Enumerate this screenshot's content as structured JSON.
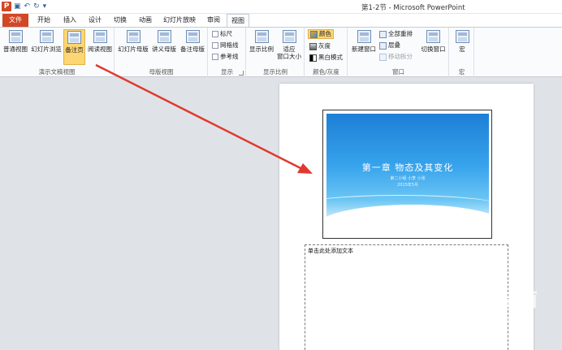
{
  "window": {
    "app_logo": "P",
    "title": "第1-2节 - Microsoft PowerPoint",
    "qat": [
      "save-icon",
      "undo-icon",
      "redo-icon",
      "customize-icon"
    ]
  },
  "tabs": [
    {
      "label": "文件"
    },
    {
      "label": "开始"
    },
    {
      "label": "插入"
    },
    {
      "label": "设计"
    },
    {
      "label": "切换"
    },
    {
      "label": "动画"
    },
    {
      "label": "幻灯片放映"
    },
    {
      "label": "审阅"
    },
    {
      "label": "视图"
    }
  ],
  "ribbon": {
    "presentation_views": {
      "label": "演示文稿视图",
      "buttons": [
        {
          "label": "普通视图"
        },
        {
          "label": "幻灯片浏览"
        },
        {
          "label": "备注页"
        },
        {
          "label": "阅读视图"
        }
      ]
    },
    "master_views": {
      "label": "母版视图",
      "buttons": [
        {
          "label": "幻灯片母版"
        },
        {
          "label": "讲义母版"
        },
        {
          "label": "备注母版"
        }
      ]
    },
    "show": {
      "label": "显示",
      "items": [
        {
          "label": "标尺",
          "checked": false
        },
        {
          "label": "网格线",
          "checked": false
        },
        {
          "label": "参考线",
          "checked": false
        }
      ]
    },
    "zoom": {
      "label": "显示比例",
      "buttons": [
        {
          "label": "显示比例"
        },
        {
          "label": "适应"
        },
        {
          "label": "窗口大小"
        }
      ]
    },
    "color_gray": {
      "label": "颜色/灰度",
      "items": [
        {
          "label": "颜色"
        },
        {
          "label": "灰度"
        },
        {
          "label": "黑白模式"
        }
      ]
    },
    "window": {
      "label": "窗口",
      "new_window": "新建窗口",
      "items": [
        {
          "label": "全部重排"
        },
        {
          "label": "层叠"
        },
        {
          "label": "移动拆分"
        }
      ],
      "switch_window": "切换窗口"
    },
    "macros": {
      "label": "宏",
      "button": "宏"
    }
  },
  "slide": {
    "title": "第一章 物态及其变化",
    "sub1": "第二小组 小李 小张",
    "sub2": "2015年5月"
  },
  "notes": {
    "placeholder": "单击此处添加文本"
  },
  "watermark": {
    "logo_char": "S",
    "name": "搜狗指南",
    "url": "zhinan.sogou.com"
  },
  "colors": {
    "file_tab": "#d24726",
    "selected_button": "#fcd673",
    "annotation_arrow": "#e03a2f"
  }
}
